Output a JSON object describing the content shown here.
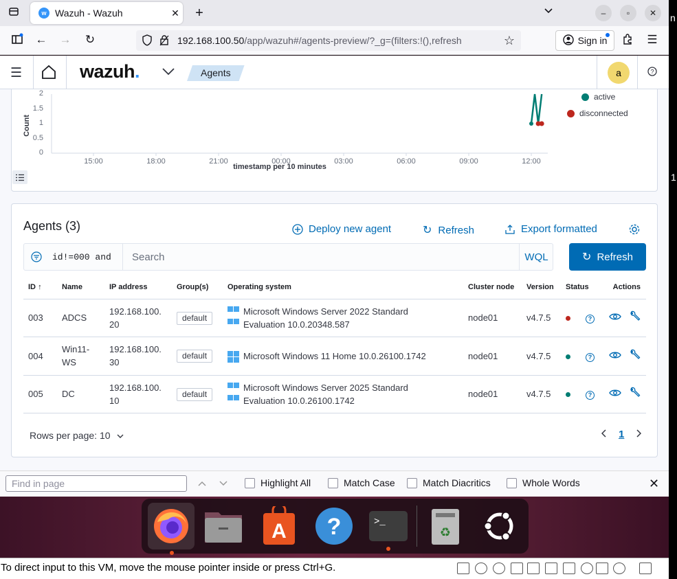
{
  "browser": {
    "tab_title": "Wazuh - Wazuh",
    "favicon_letter": "w",
    "url_host": "192.168.100.50",
    "url_path": "/app/wazuh#/agents-preview/?_g=(filters:!(),refresh",
    "sign_in_label": "Sign in"
  },
  "header": {
    "logo_text": "wazuh",
    "logo_dot": ".",
    "breadcrumb": "Agents",
    "avatar_letter": "a"
  },
  "chart_data": {
    "type": "line",
    "y_axis_label": "Count",
    "x_axis_label": "timestamp per 10 minutes",
    "y_ticks": [
      "2",
      "1.5",
      "1",
      "0.5",
      "0"
    ],
    "x_ticks": [
      "15:00",
      "18:00",
      "21:00",
      "00:00",
      "03:00",
      "06:00",
      "09:00",
      "12:00"
    ],
    "ylim": [
      0,
      2
    ],
    "series": [
      {
        "name": "active",
        "color": "#017d73",
        "points": [
          [
            "12:00",
            1
          ],
          [
            "12:10",
            2
          ],
          [
            "12:20",
            1
          ],
          [
            "12:30",
            2
          ]
        ]
      },
      {
        "name": "disconnected",
        "color": "#bd271e",
        "points": [
          [
            "12:20",
            1
          ],
          [
            "12:30",
            1
          ]
        ]
      }
    ],
    "legend_placement": "top-right"
  },
  "agents": {
    "title": "Agents (3)",
    "deploy_label": "Deploy new agent",
    "refresh_label": "Refresh",
    "export_label": "Export formatted",
    "filter_chip": "id!=000 and",
    "search_placeholder": "Search",
    "wql_label": "WQL",
    "refresh_button": "Refresh",
    "columns": [
      "ID",
      "Name",
      "IP address",
      "Group(s)",
      "Operating system",
      "Cluster node",
      "Version",
      "Status",
      "Actions"
    ],
    "rows": [
      {
        "id": "003",
        "name": "ADCS",
        "ip": "192.168.100.\n20",
        "group": "default",
        "os": "Microsoft Windows Server 2022 Standard Evaluation 10.0.20348.587",
        "node": "node01",
        "version": "v4.7.5",
        "status_color": "#bd271e"
      },
      {
        "id": "004",
        "name": "Win11-\nWS",
        "ip": "192.168.100.\n30",
        "group": "default",
        "os": "Microsoft Windows 11 Home 10.0.26100.1742",
        "node": "node01",
        "version": "v4.7.5",
        "status_color": "#017d73"
      },
      {
        "id": "005",
        "name": "DC",
        "ip": "192.168.100.\n10",
        "group": "default",
        "os": "Microsoft Windows Server 2025 Standard Evaluation 10.0.26100.1742",
        "node": "node01",
        "version": "v4.7.5",
        "status_color": "#017d73"
      }
    ],
    "rows_per_page": "Rows per page: 10",
    "current_page": "1"
  },
  "findbar": {
    "placeholder": "Find in page",
    "options": [
      "Highlight All",
      "Match Case",
      "Match Diacritics",
      "Whole Words"
    ]
  },
  "vm_status": {
    "message": "To direct input to this VM, move the mouse pointer inside or press Ctrl+G."
  },
  "right_strip": {
    "top_char": "n",
    "mid_char": "1"
  }
}
